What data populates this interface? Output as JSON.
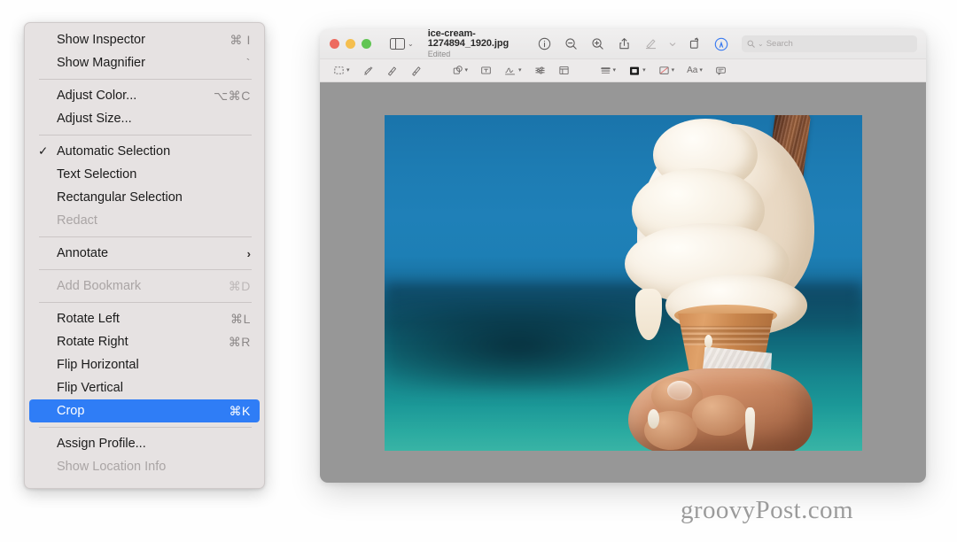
{
  "context_menu": {
    "groups": [
      [
        {
          "id": "show-inspector",
          "label": "Show Inspector",
          "shortcut": "⌘ I",
          "state": "normal",
          "checked": false
        },
        {
          "id": "show-magnifier",
          "label": "Show Magnifier",
          "shortcut": "`",
          "state": "normal",
          "checked": false
        }
      ],
      [
        {
          "id": "adjust-color",
          "label": "Adjust Color...",
          "shortcut": "⌥⌘C",
          "state": "normal",
          "checked": false
        },
        {
          "id": "adjust-size",
          "label": "Adjust Size...",
          "shortcut": "",
          "state": "normal",
          "checked": false
        }
      ],
      [
        {
          "id": "automatic-selection",
          "label": "Automatic Selection",
          "shortcut": "",
          "state": "normal",
          "checked": true
        },
        {
          "id": "text-selection",
          "label": "Text Selection",
          "shortcut": "",
          "state": "normal",
          "checked": false
        },
        {
          "id": "rectangular-selection",
          "label": "Rectangular Selection",
          "shortcut": "",
          "state": "normal",
          "checked": false
        },
        {
          "id": "redact",
          "label": "Redact",
          "shortcut": "",
          "state": "disabled",
          "checked": false
        }
      ],
      [
        {
          "id": "annotate",
          "label": "Annotate",
          "shortcut": "",
          "state": "normal",
          "checked": false,
          "submenu": true
        }
      ],
      [
        {
          "id": "add-bookmark",
          "label": "Add Bookmark",
          "shortcut": "⌘D",
          "state": "disabled",
          "checked": false
        }
      ],
      [
        {
          "id": "rotate-left",
          "label": "Rotate Left",
          "shortcut": "⌘L",
          "state": "normal",
          "checked": false
        },
        {
          "id": "rotate-right",
          "label": "Rotate Right",
          "shortcut": "⌘R",
          "state": "normal",
          "checked": false
        },
        {
          "id": "flip-horizontal",
          "label": "Flip Horizontal",
          "shortcut": "",
          "state": "normal",
          "checked": false
        },
        {
          "id": "flip-vertical",
          "label": "Flip Vertical",
          "shortcut": "",
          "state": "normal",
          "checked": false
        },
        {
          "id": "crop",
          "label": "Crop",
          "shortcut": "⌘K",
          "state": "selected",
          "checked": false
        }
      ],
      [
        {
          "id": "assign-profile",
          "label": "Assign Profile...",
          "shortcut": "",
          "state": "normal",
          "checked": false
        },
        {
          "id": "show-location-info",
          "label": "Show Location Info",
          "shortcut": "",
          "state": "disabled",
          "checked": false
        }
      ]
    ],
    "checkmark_glyph": "✓",
    "submenu_glyph": "›",
    "highlight_color": "#2f7df6"
  },
  "window": {
    "traffic_lights": {
      "close_label": "close",
      "minimize_label": "minimize",
      "zoom_label": "zoom",
      "close_color": "#ed6a5f",
      "minimize_color": "#f5bf4f",
      "zoom_color": "#61c554"
    },
    "sidebar_toggle": {
      "icon": "sidebar-icon",
      "caret": "⌄"
    },
    "document_title": "ice-cream-1274894_1920.jpg",
    "document_status": "Edited",
    "toolbar": [
      {
        "id": "info",
        "icon": "info-circle-icon",
        "label": "Info",
        "state": "normal"
      },
      {
        "id": "zoom-out",
        "icon": "zoom-out-icon",
        "label": "Zoom Out",
        "state": "normal"
      },
      {
        "id": "zoom-in",
        "icon": "zoom-in-icon",
        "label": "Zoom In",
        "state": "normal"
      },
      {
        "id": "share",
        "icon": "share-icon",
        "label": "Share",
        "state": "normal"
      },
      {
        "id": "markup",
        "icon": "markup-pen-icon",
        "label": "Markup",
        "state": "muted"
      },
      {
        "id": "markup-caret",
        "icon": "chevron-down-icon",
        "label": "Markup options",
        "state": "muted"
      },
      {
        "id": "rotate",
        "icon": "rotate-icon",
        "label": "Rotate",
        "state": "normal"
      },
      {
        "id": "accessibility",
        "icon": "accessibility-icon",
        "label": "Accessibility",
        "state": "accent"
      }
    ],
    "search": {
      "placeholder": "Search",
      "icon": "search-icon",
      "caret": "⌄"
    },
    "annotation_bar": [
      {
        "id": "selection-tool",
        "icon": "rect-selection-icon",
        "caret": true
      },
      {
        "id": "instant-alpha",
        "icon": "instant-alpha-icon",
        "caret": false
      },
      {
        "id": "sketch",
        "icon": "sketch-icon",
        "caret": false
      },
      {
        "id": "draw",
        "icon": "draw-icon",
        "caret": false
      },
      {
        "id": "shapes",
        "icon": "shapes-icon",
        "caret": true
      },
      {
        "id": "text-box",
        "icon": "text-box-icon",
        "caret": false
      },
      {
        "id": "sign",
        "icon": "signature-icon",
        "caret": true
      },
      {
        "id": "adjust-color",
        "icon": "sliders-icon",
        "caret": false
      },
      {
        "id": "adjust-size",
        "icon": "adjust-size-icon",
        "caret": false
      },
      {
        "id": "shape-style",
        "icon": "shape-style-icon",
        "caret": true
      },
      {
        "id": "border-color",
        "icon": "border-color-icon",
        "caret": true
      },
      {
        "id": "fill-color",
        "icon": "fill-color-icon",
        "caret": true
      },
      {
        "id": "text-style",
        "icon": "text-style-icon",
        "label": "Aa",
        "caret": true
      },
      {
        "id": "add-note",
        "icon": "note-icon",
        "caret": false
      }
    ],
    "canvas": {
      "background_color": "#979797",
      "image_alt": "Soft-serve ice cream cone with chocolate flake held in a hand against a blue sea and sky"
    }
  },
  "watermark": {
    "text": "groovyPost.com"
  }
}
